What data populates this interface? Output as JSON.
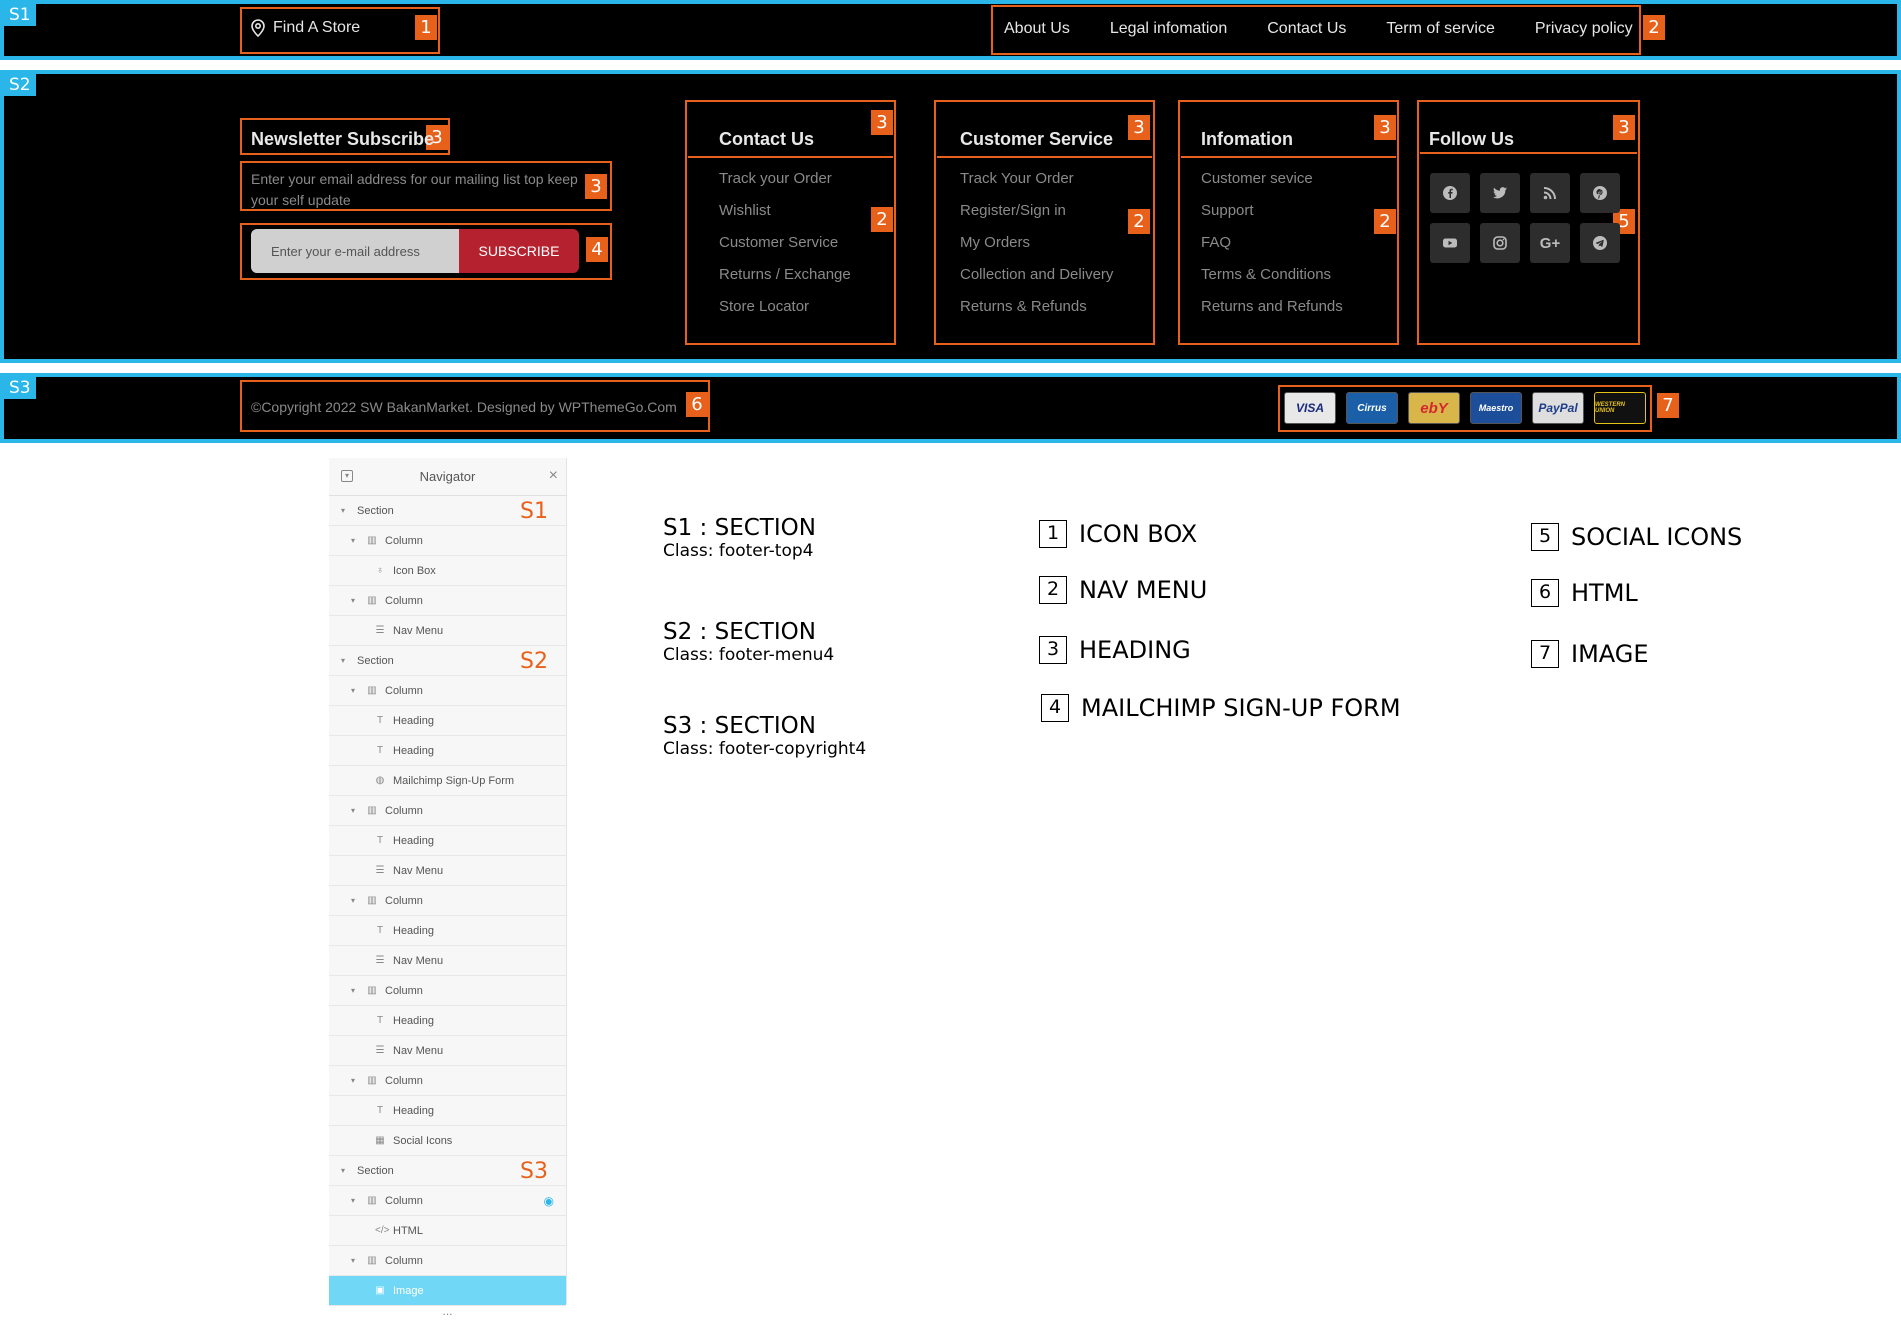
{
  "sections": {
    "s1_tag": "S1",
    "s2_tag": "S2",
    "s3_tag": "S3"
  },
  "markers": [
    "1",
    "2",
    "3",
    "4",
    "5",
    "6",
    "7"
  ],
  "top_bar": {
    "find_store": "Find A Store",
    "nav": [
      "About Us",
      "Legal infomation",
      "Contact Us",
      "Term of service",
      "Privacy policy"
    ]
  },
  "newsletter": {
    "title": "Newsletter Subscribe",
    "text": "Enter your email address for our mailing list top keep your self update",
    "placeholder": "Enter your e-mail address",
    "button": "SUBSCRIBE"
  },
  "columns": [
    {
      "title": "Contact Us",
      "items": [
        "Track your Order",
        "Wishlist",
        "Customer Service",
        "Returns / Exchange",
        "Store Locator"
      ]
    },
    {
      "title": "Customer Service",
      "items": [
        "Track Your Order",
        "Register/Sign in",
        "My Orders",
        "Collection and Delivery",
        "Returns & Refunds"
      ]
    },
    {
      "title": "Infomation",
      "items": [
        "Customer sevice",
        "Support",
        "FAQ",
        "Terms & Conditions",
        "Returns and Refunds"
      ]
    }
  ],
  "follow": {
    "title": "Follow Us",
    "icons": [
      "facebook-icon",
      "twitter-icon",
      "rss-icon",
      "pinterest-icon",
      "youtube-icon",
      "instagram-icon",
      "google-plus-icon",
      "telegram-icon"
    ]
  },
  "copyright": "©Copyright 2022 SW BakanMarket. Designed by WPThemeGo.Com",
  "payment_cards": [
    "VISA",
    "Cirrus",
    "ebY",
    "Maestro",
    "PayPal",
    "WESTERN UNION"
  ],
  "navigator": {
    "title": "Navigator",
    "rows": [
      {
        "label": "Section",
        "tag": "S1"
      },
      {
        "label": "Column"
      },
      {
        "label": "Icon Box"
      },
      {
        "label": "Column"
      },
      {
        "label": "Nav Menu"
      },
      {
        "label": "Section",
        "tag": "S2"
      },
      {
        "label": "Column"
      },
      {
        "label": "Heading"
      },
      {
        "label": "Heading"
      },
      {
        "label": "Mailchimp Sign-Up Form"
      },
      {
        "label": "Column"
      },
      {
        "label": "Heading"
      },
      {
        "label": "Nav Menu"
      },
      {
        "label": "Column"
      },
      {
        "label": "Heading"
      },
      {
        "label": "Nav Menu"
      },
      {
        "label": "Column"
      },
      {
        "label": "Heading"
      },
      {
        "label": "Nav Menu"
      },
      {
        "label": "Column"
      },
      {
        "label": "Heading"
      },
      {
        "label": "Social Icons"
      },
      {
        "label": "Section",
        "tag": "S3"
      },
      {
        "label": "Column"
      },
      {
        "label": "HTML"
      },
      {
        "label": "Column"
      },
      {
        "label": "Image"
      }
    ],
    "more": "..."
  },
  "legend": {
    "sections": [
      {
        "title": "S1 : SECTION",
        "class": "Class: footer-top4"
      },
      {
        "title": "S2 : SECTION",
        "class": "Class: footer-menu4"
      },
      {
        "title": "S3 : SECTION",
        "class": "Class: footer-copyright4"
      }
    ],
    "widgets": [
      {
        "num": "1",
        "label": "ICON BOX"
      },
      {
        "num": "2",
        "label": "NAV MENU"
      },
      {
        "num": "3",
        "label": "HEADING"
      },
      {
        "num": "4",
        "label": "MAILCHIMP SIGN-UP FORM"
      },
      {
        "num": "5",
        "label": "SOCIAL ICONS"
      },
      {
        "num": "6",
        "label": "HTML"
      },
      {
        "num": "7",
        "label": "IMAGE"
      }
    ]
  }
}
